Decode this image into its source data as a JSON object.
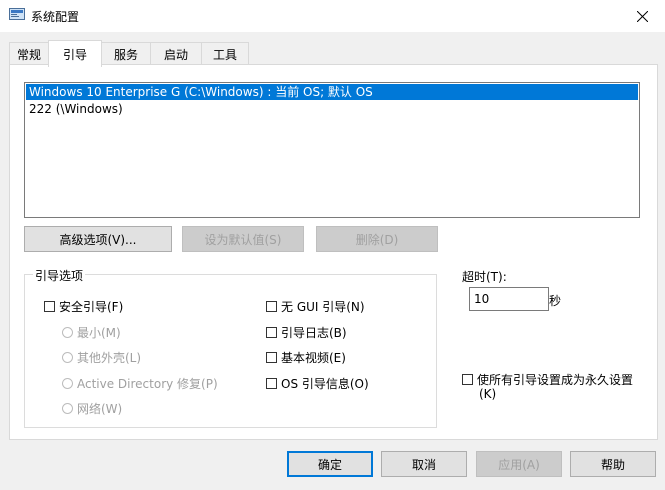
{
  "window": {
    "title": "系统配置"
  },
  "tabs": [
    {
      "label": "常规"
    },
    {
      "label": "引导"
    },
    {
      "label": "服务"
    },
    {
      "label": "启动"
    },
    {
      "label": "工具"
    }
  ],
  "os_list": [
    {
      "label": "Windows 10 Enterprise G (C:\\Windows) : 当前 OS; 默认 OS",
      "selected": true
    },
    {
      "label": "222 (\\Windows)",
      "selected": false
    }
  ],
  "buttons": {
    "advanced": "高级选项(V)...",
    "set_default": "设为默认值(S)",
    "delete": "删除(D)",
    "ok": "确定",
    "cancel": "取消",
    "apply": "应用(A)",
    "help": "帮助"
  },
  "boot_options": {
    "group_label": "引导选项",
    "safe_boot": "安全引导(F)",
    "radios": [
      "最小(M)",
      "其他外壳(L)",
      "Active Directory 修复(P)",
      "网络(W)"
    ],
    "no_gui": "无 GUI 引导(N)",
    "boot_log": "引导日志(B)",
    "base_video": "基本视频(E)",
    "os_boot_info": "OS 引导信息(O)"
  },
  "timeout": {
    "label": "超时(T):",
    "value": "10",
    "unit": "秒"
  },
  "permanent": {
    "line1": "使所有引导设置成为永久设置",
    "line2": "(K)"
  },
  "colors": {
    "selection": "#0078d7",
    "default_button_border": "#0078d7"
  }
}
